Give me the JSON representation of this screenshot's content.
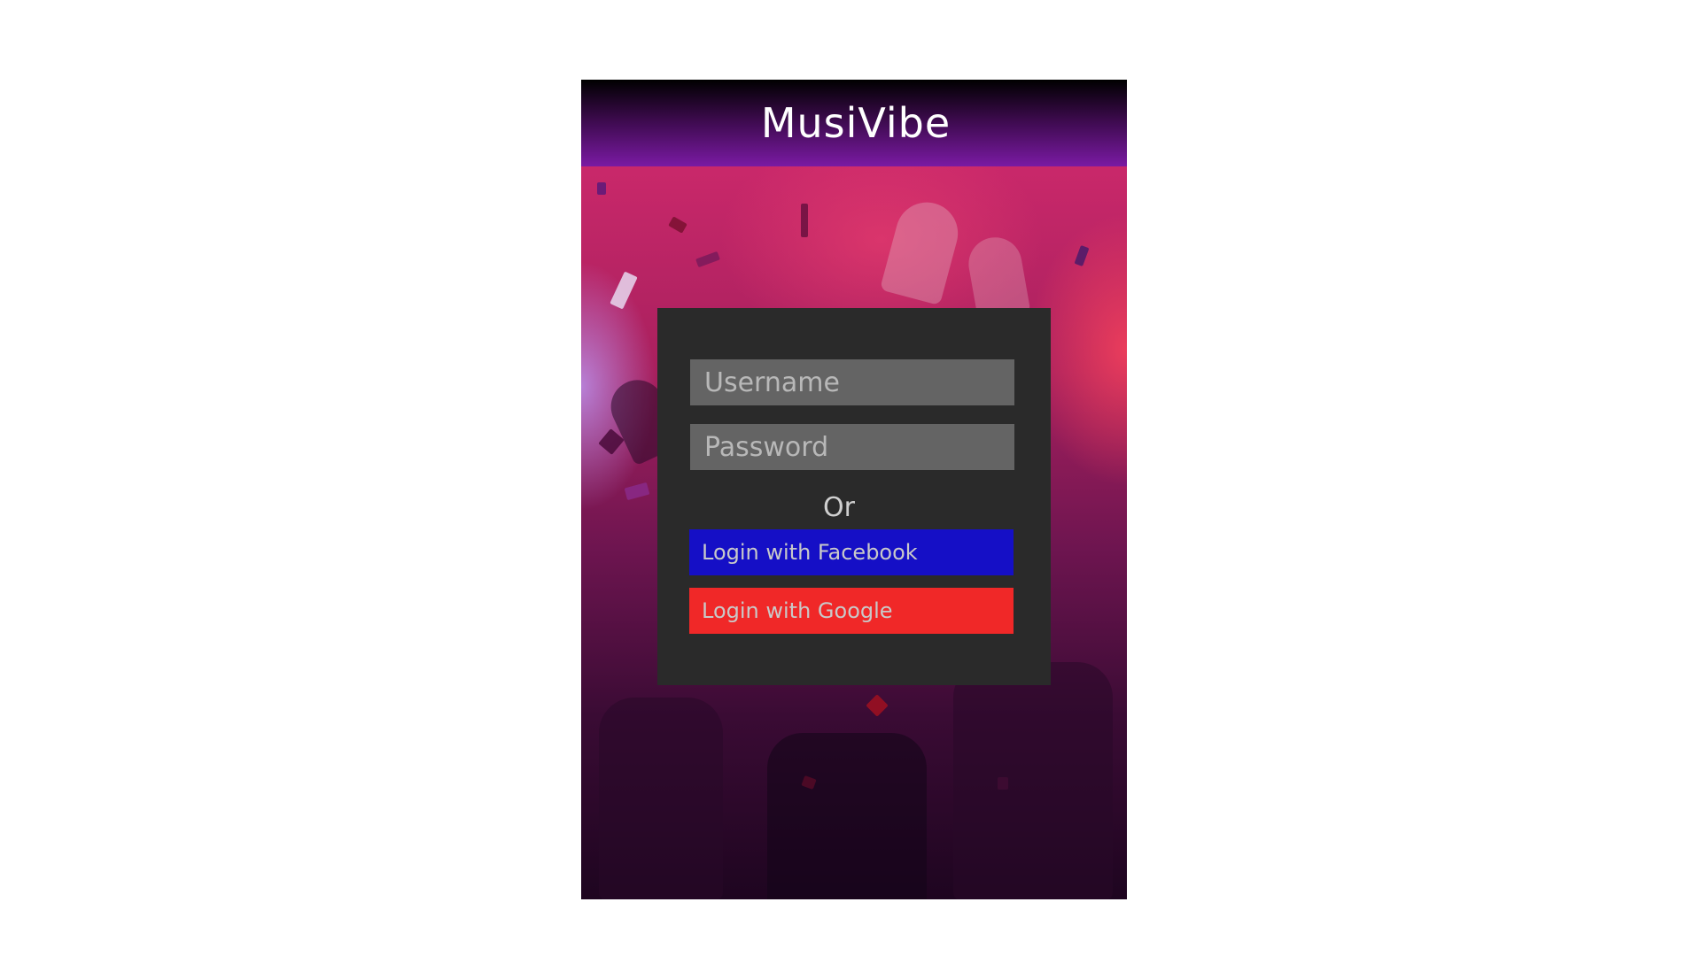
{
  "header": {
    "title": "MusiVibe"
  },
  "login": {
    "username_placeholder": "Username",
    "password_placeholder": "Password",
    "or_label": "Or",
    "facebook_label": "Login with Facebook",
    "google_label": "Login with Google"
  },
  "colors": {
    "facebook": "#150fc6",
    "google": "#f02828",
    "card": "#2a2a2a",
    "field": "#646464",
    "header_accent": "#7a1aa3"
  }
}
